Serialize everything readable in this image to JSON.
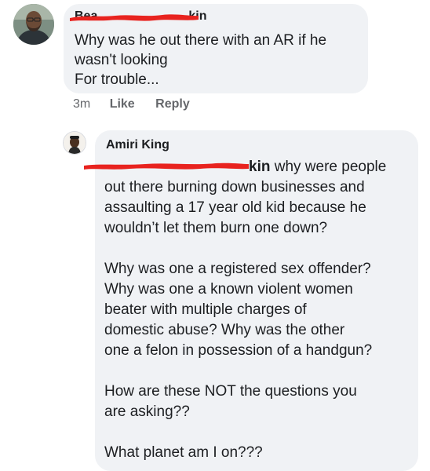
{
  "comment": {
    "author_visible": "Bea",
    "author_visible_tail": "kin",
    "lines": [
      "Why was he out there with an AR if he",
      "wasn't looking",
      "For trouble..."
    ],
    "timestamp": "3m",
    "like_label": "Like",
    "reply_label": "Reply"
  },
  "reply": {
    "author": "Amiri King",
    "mention_tail": "kin",
    "first_line_rest": " why were people",
    "paragraph1": [
      "out there burning down businesses and",
      "assaulting a 17 year old kid because he",
      "wouldn’t let them burn one down?"
    ],
    "paragraph2": [
      "Why was one a registered sex offender?",
      "Why was one a known violent women",
      "beater with multiple charges of",
      "domestic abuse? Why was the other",
      "one a felon in possession of a handgun?"
    ],
    "paragraph3": [
      "How are these NOT the questions you",
      "are asking??"
    ],
    "paragraph4": [
      "What planet am I on???"
    ]
  },
  "colors": {
    "bubble": "#f0f2f5",
    "text": "#1c1e21",
    "meta": "#65676b",
    "redaction": "#e8231f"
  },
  "icons": {
    "commenter_avatar": "user-photo",
    "replier_avatar": "user-photo"
  }
}
